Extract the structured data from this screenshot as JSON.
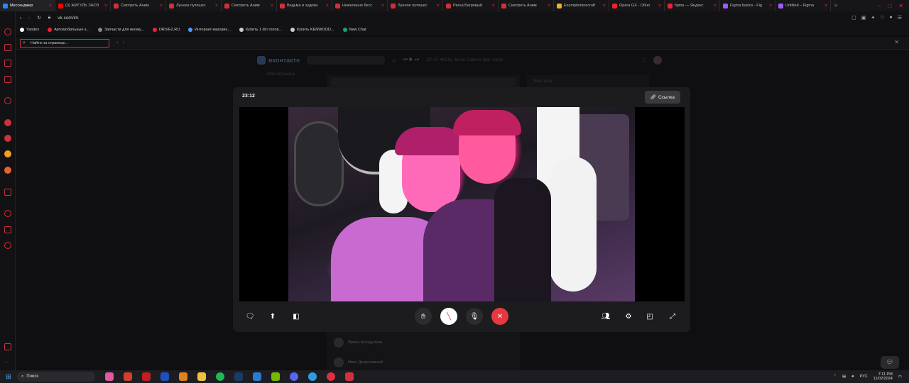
{
  "browser": {
    "tabs": [
      {
        "label": "Мессенджер",
        "color": "#2787f5",
        "active": true
      },
      {
        "label": "(3) ЖИГУЛЬ ЗНОЗ",
        "color": "#ff0000"
      },
      {
        "label": "Смотреть Аним",
        "color": "#d0303a"
      },
      {
        "label": "Лунное путешес",
        "color": "#d0303a"
      },
      {
        "label": "Смотреть Аним",
        "color": "#d0303a"
      },
      {
        "label": "Ведьма и чудови",
        "color": "#d0303a"
      },
      {
        "label": "Нежеланно бесс",
        "color": "#d0303a"
      },
      {
        "label": "Лунное путешес",
        "color": "#d0303a"
      },
      {
        "label": "Рагна Багровый",
        "color": "#d0303a"
      },
      {
        "label": "Смотреть Аним",
        "color": "#d0303a"
      },
      {
        "label": "Еxampleminecraft",
        "color": "#f0b020"
      },
      {
        "label": "Opera GX - Обно",
        "color": "#e23"
      },
      {
        "label": "figma — Яндекс",
        "color": "#e23"
      },
      {
        "label": "Figma basics - Fig",
        "color": "#a259ff"
      },
      {
        "label": "Untitled – Figma",
        "color": "#a259ff"
      }
    ],
    "new_tab": "+",
    "address": "vk.com/im",
    "bookmarks": [
      {
        "label": "Yandex",
        "color": "#fff"
      },
      {
        "label": "Автомобильные к...",
        "color": "#e23"
      },
      {
        "label": "Запчасти для иному...",
        "color": "#888"
      },
      {
        "label": "DRIVE2.RU",
        "color": "#e23"
      },
      {
        "label": "Интернет-магазин...",
        "color": "#4aa0ff"
      },
      {
        "label": "Купить 1 din голов...",
        "color": "#ccc"
      },
      {
        "label": "Купить KENWOOD...",
        "color": "#ccc"
      },
      {
        "label": "New Chat",
        "color": "#10a37f"
      }
    ],
    "find_placeholder": "Найти на странице..."
  },
  "vk": {
    "logo_text": "вконтакте",
    "now_playing": "[20-47-4813c] Junior Caldera feat. Sophi...",
    "my_page": "Моя страница",
    "all_chats": "Все чаты",
    "contacts": [
      "Ирина Ассадулина",
      "Иван Депресивный"
    ]
  },
  "call": {
    "timer": "23:12",
    "link_label": "Ссылка",
    "link_icon": "link-icon",
    "controls_left": [
      "chat-icon",
      "share-screen-icon",
      "screenshare-alt-icon"
    ],
    "controls_center": [
      "raise-hand-icon",
      "camera-off-icon",
      "microphone-icon",
      "hang-up-icon"
    ],
    "controls_right": [
      "participants-icon",
      "settings-icon",
      "layout-icon",
      "fullscreen-icon"
    ],
    "hangup_color": "#e5393f"
  },
  "taskbar": {
    "search_label": "Поиск",
    "lang": "РУС",
    "time": "7:11 PM",
    "date": "11/02/2024"
  }
}
